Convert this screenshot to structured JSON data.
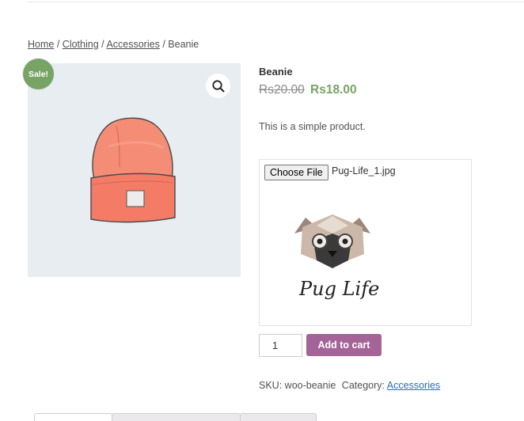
{
  "breadcrumb": {
    "items": [
      {
        "label": "Home",
        "link": true
      },
      {
        "label": "Clothing",
        "link": true
      },
      {
        "label": "Accessories",
        "link": true
      },
      {
        "label": "Beanie",
        "link": false
      }
    ],
    "separator": "/"
  },
  "gallery": {
    "sale_badge": "Sale!",
    "zoom_icon": "magnifier-icon",
    "image_subject": "beanie"
  },
  "product": {
    "title": "Beanie",
    "price_old": "Rs20.00",
    "price_new": "Rs18.00",
    "description": "This is a simple product."
  },
  "upload": {
    "button_label": "Choose File",
    "file_name": "Pug-Life_1.jpg",
    "preview_caption": "Pug Life"
  },
  "cart": {
    "quantity": "1",
    "add_label": "Add to cart"
  },
  "meta": {
    "sku_label": "SKU:",
    "sku_value": "woo-beanie",
    "category_label": "Category:",
    "category_value": "Accessories"
  },
  "colors": {
    "sale": "#77a464",
    "price_new": "#77a464",
    "button": "#a46497",
    "link": "#2a6ebb",
    "gallery_bg": "#e8edf2"
  }
}
